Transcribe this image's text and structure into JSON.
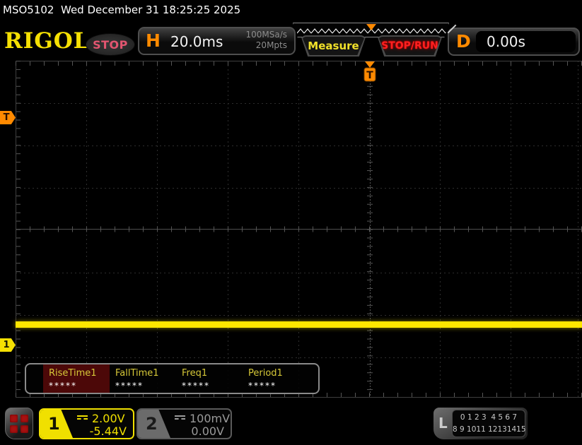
{
  "titlebar": {
    "model": "MSO5102",
    "datetime": "Wed December 31 18:25:25 2025"
  },
  "header": {
    "logo": "RIGOL",
    "run_state": "STOP",
    "horizontal": {
      "label": "H",
      "timebase": "20.0ms",
      "sample_rate": "100MSa/s",
      "mem_depth": "20Mpts"
    },
    "measure_label": "Measure",
    "stoprun_label": "STOP/RUN",
    "delay": {
      "label": "D",
      "value": "0.00s"
    }
  },
  "markers": {
    "trigger_pos_label": "T",
    "trigger_level_label": "T",
    "channel1_label": "1"
  },
  "measurements": {
    "items": [
      {
        "label": "RiseTime1",
        "value": "*****",
        "selected": true
      },
      {
        "label": "FallTime1",
        "value": "*****",
        "selected": false
      },
      {
        "label": "Freq1",
        "value": "*****",
        "selected": false
      },
      {
        "label": "Period1",
        "value": "*****",
        "selected": false
      }
    ]
  },
  "channels": [
    {
      "id": "1",
      "coupling": "DC",
      "scale": "2.00V",
      "offset": "-5.44V",
      "active": true
    },
    {
      "id": "2",
      "coupling": "DC",
      "scale": "100mV",
      "offset": "0.00V",
      "active": false
    }
  ],
  "logic": {
    "label": "L",
    "row1": "0 1 2 3  4 5 6 7",
    "row2": "8 9 1011 12131415"
  },
  "colors": {
    "channel1_yellow": "#f5e003",
    "trace_yellow": "#ffe600",
    "accent_orange": "#ff8a00",
    "stoprun_red": "#ff2020",
    "runstate_pink": "#e25570",
    "measure_label_yellow": "#d6c838",
    "selected_cell_red": "#4c0808",
    "grid_gray": "#2e2e2e"
  }
}
